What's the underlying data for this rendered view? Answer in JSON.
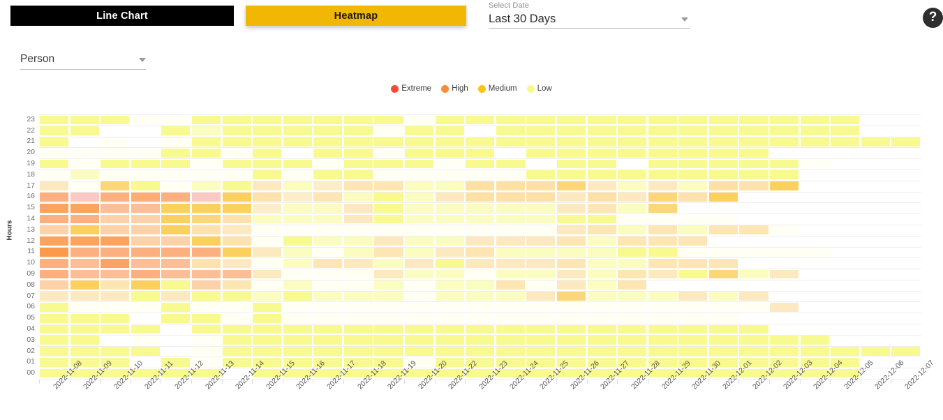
{
  "tabs": [
    {
      "id": "line-chart",
      "label": "Line Chart",
      "active": false
    },
    {
      "id": "heatmap",
      "label": "Heatmap",
      "active": true
    }
  ],
  "date_select": {
    "label": "Select Date",
    "value": "Last 30 Days",
    "caret_icon": "chevron-down-icon"
  },
  "person_select": {
    "value": "Person",
    "caret_icon": "chevron-down-icon"
  },
  "help": {
    "icon": "help-circle-icon",
    "glyph": "?"
  },
  "legend": [
    {
      "label": "Extreme",
      "color": "#fb4a34"
    },
    {
      "label": "High",
      "color": "#fb8c34"
    },
    {
      "label": "Medium",
      "color": "#fcc318"
    },
    {
      "label": "Low",
      "color": "#f7f98a"
    }
  ],
  "colors": {
    "tab_active_bg": "#f2b705",
    "tab_inactive_bg": "#000000",
    "grid_line": "#eeeeee",
    "page_bg": "#ffffff"
  },
  "chart_data": {
    "type": "heatmap",
    "title": "",
    "xlabel": "",
    "ylabel": "Hours",
    "legend_position": "top-center",
    "grid": true,
    "scale": [
      {
        "name": "Low",
        "color": "#f7f98a"
      },
      {
        "name": "Medium",
        "color": "#fcc318"
      },
      {
        "name": "High",
        "color": "#fb8c34"
      },
      {
        "name": "Extreme",
        "color": "#fb4a34"
      }
    ],
    "x": [
      "2022-11-08",
      "2022-11-09",
      "2022-11-10",
      "2022-11-11",
      "2022-11-12",
      "2022-11-13",
      "2022-11-14",
      "2022-11-15",
      "2022-11-16",
      "2022-11-17",
      "2022-11-18",
      "2022-11-19",
      "2022-11-20",
      "2022-11-22",
      "2022-11-23",
      "2022-11-24",
      "2022-11-25",
      "2022-11-26",
      "2022-11-27",
      "2022-11-28",
      "2022-11-29",
      "2022-11-30",
      "2022-12-01",
      "2022-12-02",
      "2022-12-03",
      "2022-12-04",
      "2022-12-05",
      "2022-12-06",
      "2022-12-07"
    ],
    "y": [
      "23",
      "22",
      "21",
      "20",
      "19",
      "18",
      "17",
      "16",
      "15",
      "14",
      "13",
      "12",
      "11",
      "10",
      "09",
      "08",
      "07",
      "06",
      "05",
      "04",
      "03",
      "02",
      "01",
      "00"
    ],
    "cells": [
      [
        "#f8fa8f",
        "#f8fa8f",
        "#f8fa8f",
        "#fffff4",
        "#fffff4",
        "#f8fa8f",
        "#f8fa8f",
        "#f8fa8f",
        "#f8fa8f",
        "#f8fa8f",
        "#f8fa8f",
        "#f8fa8f",
        "#fffff4",
        "#f8fa8f",
        "#f8fa8f",
        "#f8fa8f",
        "#f8fa8f",
        "#f8fa8f",
        "#f8fa8f",
        "#f8fa8f",
        "#f8fa8f",
        "#f8fa8f",
        "#f8fa8f",
        "#f8fa8f",
        "#f8fa8f",
        "#f8fa8f",
        "#f8fa8f",
        null,
        null
      ],
      [
        "#f8fa8f",
        "#f8fa8f",
        "#ffffff",
        "#ffffff",
        "#f8fa8f",
        "#fbfcc0",
        "#f8fa8f",
        "#f8fa8f",
        "#f8fa8f",
        "#f8fa8f",
        "#f8fa8f",
        "#fffff4",
        "#f8fa8f",
        "#f8fa8f",
        "#ffffff",
        "#f8fa8f",
        "#f8fa8f",
        "#f8fa8f",
        "#f8fa8f",
        "#f8fa8f",
        "#f8fa8f",
        "#f8fa8f",
        "#f8fa8f",
        "#f8fa8f",
        "#f8fa8f",
        "#f8fa8f",
        "#f8fa8f",
        null,
        null
      ],
      [
        "#f8fa8f",
        "#ffffff",
        "#fffff4",
        "#ffffff",
        "#fffff4",
        "#f8fa8f",
        "#f8fa8f",
        "#f8fa8f",
        "#f8fa8f",
        "#f8fa8f",
        "#f8fa8f",
        "#f8fa8f",
        "#f8fa8f",
        "#f8fa8f",
        "#f8fa8f",
        "#f8fa8f",
        "#f8fa8f",
        "#f8fa8f",
        "#f8fa8f",
        "#f8fa8f",
        "#f8fa8f",
        "#f8fa8f",
        "#f8fa8f",
        "#f8fa8f",
        "#f8fa8f",
        "#f8fa8f",
        "#f8fa8f",
        "#f8fa8f",
        "#f8fa8f"
      ],
      [
        "#fffff4",
        "#fffff4",
        "#fffff4",
        "#fffff4",
        "#f8fa8f",
        "#f8fa8f",
        "#fffff4",
        "#f8fa8f",
        "#ffffff",
        "#f8fa8f",
        "#f8fa8f",
        "#fffff4",
        "#f8fa8f",
        "#f8fa8f",
        "#f8fa8f",
        "#ffffff",
        "#f8fa8f",
        "#f8fa8f",
        "#f8fa8f",
        "#f8fa8f",
        "#f8fa8f",
        "#f8fa8f",
        "#f8fa8f",
        "#f8fa8f",
        null,
        null,
        null,
        null,
        null
      ],
      [
        "#f8fa8f",
        "#fffff4",
        "#f8fa8f",
        "#f8fa8f",
        "#f8fa8f",
        "#fffff4",
        "#f8fa8f",
        "#f8fa8f",
        "#f8fa8f",
        "#fffff4",
        "#f8fa8f",
        "#f8fa8f",
        "#f8fa8f",
        "#fffff4",
        "#f8fa8f",
        "#f8fa8f",
        "#ffffff",
        "#f8fa8f",
        "#f8fa8f",
        "#ffffff",
        "#f8fa8f",
        "#f8fa8f",
        "#f8fa8f",
        "#f8fa8f",
        "#f8fa8f",
        "#fffff4",
        null,
        null,
        null
      ],
      [
        "#fffff4",
        "#fbfcc0",
        "#fffff4",
        "#fffff4",
        "#fffff4",
        "#fffff4",
        "#fffff4",
        "#f8fa8f",
        "#fffff4",
        "#f8fa8f",
        "#f8fa8f",
        "#fffff4",
        "#fffff4",
        "#fffff4",
        "#fffff4",
        "#fffff4",
        "#f8fa8f",
        "#f8fa8f",
        "#f8fa8f",
        "#f8fa8f",
        "#f8fa8f",
        "#f8fa8f",
        "#f8fa8f",
        "#f8fa8f",
        "#f8fa8f",
        null,
        null,
        null,
        null
      ],
      [
        "#fde9bf",
        "#fffff4",
        "#fcd77a",
        "#f8fa8f",
        "#fffff4",
        "#fbfcc0",
        "#f8fa8f",
        "#fde9bf",
        "#fbfcc0",
        "#fdedc9",
        "#fde5b4",
        "#fde5b4",
        "#fbfcc0",
        "#fbfcc0",
        "#fde0a4",
        "#fde0a4",
        "#fde0a4",
        "#fcd77a",
        "#fde9bf",
        "#fbfcc0",
        "#fde9bf",
        "#fbfcc0",
        "#fde0a4",
        "#fde2ae",
        "#fcd05f",
        null,
        null,
        null,
        null
      ],
      [
        "#fcb07f",
        "#fbc9c4",
        "#fcb07f",
        "#fcac74",
        "#fcb07f",
        "#fbc9c4",
        "#fcd05f",
        "#fde2ae",
        "#fdedc9",
        "#fde5b4",
        "#fbfcc0",
        "#f8fa8f",
        "#fbfcc0",
        "#fde9bf",
        "#fde0a4",
        "#fde0a4",
        "#fde0a4",
        "#fde9bf",
        "#fde0a4",
        "#fde9bf",
        "#fcd77a",
        "#fde2ae",
        "#fcd05f",
        "#ffffff",
        null,
        null,
        null,
        null,
        null
      ],
      [
        "#fba35f",
        "#fba35f",
        "#fcbe96",
        "#fcbe96",
        "#fcd05f",
        "#fcd05f",
        "#fcd05f",
        "#fdedc9",
        "#fbfcc0",
        "#fbfcc0",
        "#fde9bf",
        "#f8fa8f",
        "#fbfcc0",
        "#fbfcc0",
        "#fbfcc0",
        "#fbfcc0",
        "#fbfcc0",
        "#fde9bf",
        "#fde5b4",
        "#fbfcc0",
        "#fcd77a",
        null,
        null,
        null,
        null,
        null,
        null,
        null,
        null
      ],
      [
        "#fcb07f",
        "#fcb07f",
        "#fdd2a8",
        "#fdd2a8",
        "#fcd05f",
        "#fcd77a",
        "#fde2ae",
        "#fbfcc0",
        "#fbfcc0",
        "#fbfcc0",
        "#fde9bf",
        "#f8fa8f",
        "#fbfcc0",
        "#fbfcc0",
        "#fbfcc0",
        "#fbfcc0",
        "#fbfcc0",
        "#f8fa8f",
        "#f8fa8f",
        "#fffff4",
        "#fffff4",
        "#fffff4",
        "#fffff4",
        null,
        null,
        null,
        null,
        null,
        null
      ],
      [
        "#fdd2a8",
        "#fcd05f",
        "#fdd2a8",
        "#fdd2a8",
        "#fcd05f",
        "#fde2ae",
        "#fde9bf",
        "#fffff4",
        "#fffff4",
        "#fffff4",
        "#fffff4",
        "#fffff4",
        "#fffff4",
        "#fffff4",
        "#fffff4",
        "#fffff4",
        "#fffff4",
        "#fde9bf",
        "#fde5b4",
        "#fbfcc0",
        "#fde5b4",
        "#fbfcc0",
        "#fde5b4",
        "#fde5b4",
        "#fffff4",
        null,
        null,
        null,
        null
      ],
      [
        "#fba35f",
        "#fba35f",
        "#fba35f",
        "#fdd2a8",
        "#fdd2a8",
        "#fcd05f",
        "#fde2ae",
        "#fffff4",
        "#f8fa8f",
        "#fbfcc0",
        "#fbfcc0",
        "#fde9bf",
        "#fbfcc0",
        "#fbfcc0",
        "#fde9bf",
        "#fde9bf",
        "#fde9bf",
        "#fde5b4",
        "#fbfcc0",
        "#fde5b4",
        "#fde5b4",
        "#fde5b4",
        null,
        null,
        null,
        null,
        null,
        null,
        null
      ],
      [
        "#fb9a4a",
        "#fcb07f",
        "#fcb07f",
        "#fcb07f",
        "#fcb07f",
        "#fcb07f",
        "#fcd05f",
        "#fde9bf",
        "#fbfcc0",
        "#fffff4",
        "#fbfcc0",
        "#fde5b4",
        "#fbfcc0",
        "#fde9bf",
        "#fde5b4",
        "#fbfcc0",
        "#fbfcc0",
        "#fbfcc0",
        "#fbfcc0",
        "#f8fa8f",
        "#f8fa8f",
        "#fffff4",
        "#fffff4",
        "#fffff4",
        "#fffff4",
        "#fffff4",
        null,
        null,
        null
      ],
      [
        "#fcb07f",
        "#fcbe96",
        "#fba35f",
        "#fcbe96",
        "#fcbe96",
        "#fde2ae",
        "#fde9bf",
        "#fffff4",
        "#fbfcc0",
        "#fde5b4",
        "#fde9bf",
        "#fbfcc0",
        "#fde9bf",
        "#f8fa8f",
        "#fde9bf",
        "#fde9bf",
        "#fde9bf",
        "#fde5b4",
        "#fbfcc0",
        "#fbfcc0",
        "#fde5b4",
        "#fde5b4",
        "#fde5b4",
        null,
        null,
        null,
        null,
        null,
        null
      ],
      [
        "#fcb07f",
        "#fcbe96",
        "#fcbe96",
        "#fcb07f",
        "#fcbe96",
        "#fcbe96",
        "#fcbe96",
        "#fde9bf",
        "#fffff4",
        "#fffff4",
        "#fffff4",
        "#fde9bf",
        "#fbfcc0",
        "#fbfcc0",
        "#fffff4",
        "#fbfcc0",
        "#fbfcc0",
        "#fde9bf",
        "#fbfcc0",
        "#fde5b4",
        "#fde9bf",
        "#f8fa8f",
        "#fcd77a",
        "#fbfcc0",
        "#fde9bf",
        null,
        null,
        null,
        null
      ],
      [
        "#fdd2a8",
        "#fcd05f",
        "#fde5b4",
        "#fcd05f",
        "#f8fa8f",
        "#fdd2a8",
        "#fde5b4",
        "#fffff4",
        "#fbfcc0",
        "#fffff4",
        "#fffff4",
        "#fbfcc0",
        "#fffff4",
        "#fbfcc0",
        "#fbfcc0",
        "#fde5b4",
        "#fffff4",
        "#fde9bf",
        "#fbfcc0",
        "#fde5b4",
        null,
        null,
        null,
        null,
        null,
        null,
        null,
        null,
        null
      ],
      [
        "#fde9bf",
        "#fde9bf",
        "#fde9bf",
        "#f8fa8f",
        "#fde9bf",
        "#f8fa8f",
        "#f8fa8f",
        "#fbfcc0",
        "#f8fa8f",
        "#fbfcc0",
        "#fbfcc0",
        "#fbfcc0",
        "#fffff4",
        "#fbfcc0",
        "#fbfcc0",
        "#fbfcc0",
        "#fde9bf",
        "#fcd77a",
        "#fbfcc0",
        "#fbfcc0",
        "#fbfcc0",
        "#fde9bf",
        "#fbfcc0",
        "#fde9bf",
        null,
        null,
        null,
        null,
        null
      ],
      [
        "#f8fa8f",
        "#fffff4",
        "#fffff4",
        "#fffff4",
        "#f8fa8f",
        "#fffff4",
        "#fffff4",
        "#f8fa8f",
        "#fffff4",
        "#fffff4",
        "#fffff4",
        "#fffff4",
        "#fffff4",
        "#fffff4",
        "#fffff4",
        "#fffff4",
        "#fffff4",
        "#fffff4",
        "#fffff4",
        "#fffff4",
        "#fffff4",
        "#fffff4",
        "#fffff4",
        "#fffff4",
        "#fde9bf",
        null,
        null,
        null,
        null
      ],
      [
        "#f8fa8f",
        "#f8fa8f",
        "#f8fa8f",
        "#ffffff",
        "#f8fa8f",
        "#f8fa8f",
        "#fffff4",
        "#f8fa8f",
        "#fffff4",
        "#fffff4",
        "#fffff4",
        "#fffff4",
        "#fffff4",
        "#fffff4",
        "#fffff4",
        "#fffff4",
        "#fffff4",
        "#fffff4",
        "#fffff4",
        "#fffff4",
        "#fffff4",
        "#fffff4",
        "#fffff4",
        null,
        null,
        null,
        null,
        null,
        null
      ],
      [
        "#f8fa8f",
        "#f8fa8f",
        "#f8fa8f",
        "#f8fa8f",
        "#ffffff",
        "#f8fa8f",
        "#f8fa8f",
        "#f8fa8f",
        "#f8fa8f",
        "#f8fa8f",
        "#f8fa8f",
        "#f8fa8f",
        "#f8fa8f",
        "#f8fa8f",
        "#f8fa8f",
        "#f8fa8f",
        "#f8fa8f",
        "#f8fa8f",
        "#f8fa8f",
        "#f8fa8f",
        "#f8fa8f",
        "#f8fa8f",
        "#f8fa8f",
        "#f8fa8f",
        null,
        null,
        null,
        null,
        null
      ],
      [
        "#f8fa8f",
        "#f8fa8f",
        "#ffffff",
        "#fffff4",
        "#ffffff",
        "#fffff4",
        "#f8fa8f",
        "#f8fa8f",
        "#f8fa8f",
        "#f8fa8f",
        "#f8fa8f",
        "#f8fa8f",
        "#f8fa8f",
        "#f8fa8f",
        "#f8fa8f",
        "#f8fa8f",
        "#f8fa8f",
        "#f8fa8f",
        "#f8fa8f",
        "#f8fa8f",
        "#f8fa8f",
        "#f8fa8f",
        "#f8fa8f",
        "#f8fa8f",
        "#f8fa8f",
        "#f8fa8f",
        null,
        null,
        null
      ],
      [
        "#f8fa8f",
        "#f8fa8f",
        "#f8fa8f",
        "#f8fa8f",
        "#ffffff",
        "#fffff4",
        "#f8fa8f",
        "#f8fa8f",
        "#f8fa8f",
        "#f8fa8f",
        "#f8fa8f",
        "#f8fa8f",
        "#f8fa8f",
        "#f8fa8f",
        "#f8fa8f",
        "#f8fa8f",
        "#f8fa8f",
        "#f8fa8f",
        "#f8fa8f",
        "#f8fa8f",
        "#f8fa8f",
        "#f8fa8f",
        "#f8fa8f",
        "#f8fa8f",
        "#f8fa8f",
        "#f8fa8f",
        "#f8fa8f",
        "#f8fa8f",
        "#f8fa8f"
      ],
      [
        "#f8fa8f",
        "#f8fa8f",
        "#f8fa8f",
        "#ffffff",
        "#f8fa8f",
        "#fffff4",
        "#f8fa8f",
        "#f8fa8f",
        "#f8fa8f",
        "#f8fa8f",
        "#f8fa8f",
        "#f8fa8f",
        "#fffff4",
        "#f8fa8f",
        "#f8fa8f",
        "#f8fa8f",
        "#f8fa8f",
        "#f8fa8f",
        "#f8fa8f",
        "#f8fa8f",
        "#f8fa8f",
        "#f8fa8f",
        "#f8fa8f",
        "#f8fa8f",
        "#f8fa8f",
        "#f8fa8f",
        "#f8fa8f",
        null,
        null
      ],
      [
        "#f8fa8f",
        "#f8fa8f",
        "#f8fa8f",
        "#f8fa8f",
        "#f8fa8f",
        "#f8fa8f",
        "#ffffff",
        "#f8fa8f",
        "#f8fa8f",
        "#f8fa8f",
        "#f8fa8f",
        "#f8fa8f",
        "#f8fa8f",
        "#f8fa8f",
        "#f8fa8f",
        "#f8fa8f",
        "#f8fa8f",
        "#f8fa8f",
        "#f8fa8f",
        "#f8fa8f",
        "#f8fa8f",
        "#f8fa8f",
        "#f8fa8f",
        "#f8fa8f",
        "#f8fa8f",
        "#f8fa8f",
        "#f8fa8f",
        null,
        null
      ]
    ]
  }
}
